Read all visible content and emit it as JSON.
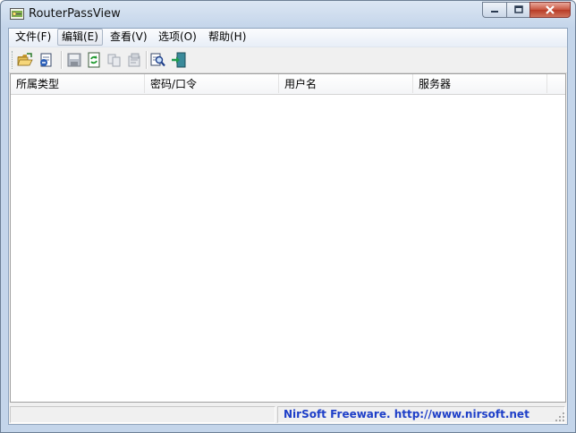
{
  "window": {
    "title": "RouterPassView"
  },
  "menu": [
    {
      "label": "文件(F)"
    },
    {
      "label": "编辑(E)"
    },
    {
      "label": "查看(V)"
    },
    {
      "label": "选项(O)"
    },
    {
      "label": "帮助(H)"
    }
  ],
  "toolbar_icons": [
    "open-folder-icon",
    "open-file-icon",
    "save-icon",
    "refresh-icon",
    "copy-icon",
    "properties-icon",
    "find-icon",
    "exit-icon"
  ],
  "columns": [
    {
      "label": "所属类型"
    },
    {
      "label": "密码/口令"
    },
    {
      "label": "用户名"
    },
    {
      "label": "服务器"
    }
  ],
  "rows": [],
  "status": {
    "link_text": "NirSoft Freeware.  http://www.nirsoft.net"
  },
  "colors": {
    "link": "#1e3fc8",
    "close_button": "#c7543f"
  }
}
